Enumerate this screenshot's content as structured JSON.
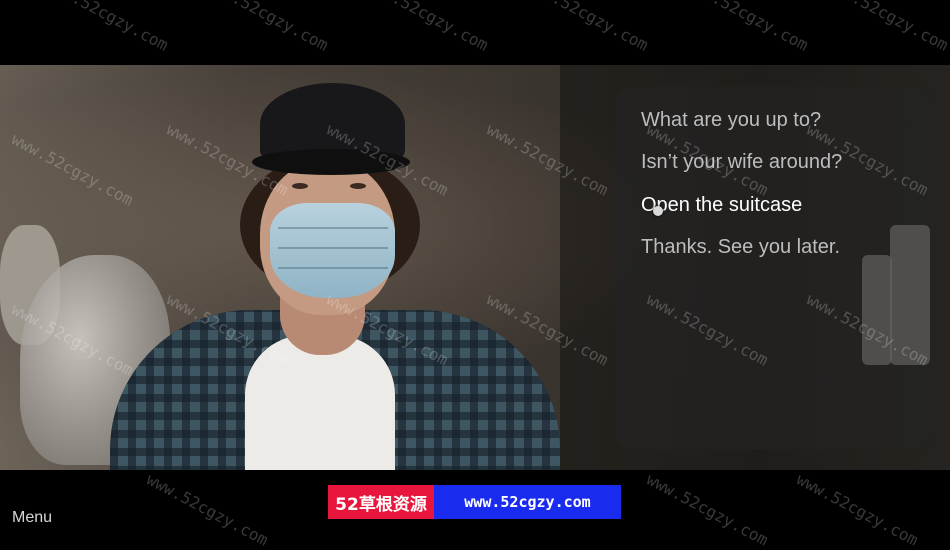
{
  "dialogue": {
    "options": [
      {
        "label": "What are you up to?",
        "selected": false
      },
      {
        "label": "Isn’t your wife around?",
        "selected": false
      },
      {
        "label": "Open the suitcase",
        "selected": true
      },
      {
        "label": "Thanks. See you later.",
        "selected": false
      }
    ]
  },
  "footer": {
    "menu_label": "Menu"
  },
  "promo_banner": {
    "left_text": "52草根资源",
    "right_text": "www.52cgzy.com",
    "left_color": "#e8163d",
    "right_color": "#1a2bf0"
  },
  "watermark_text": "www.52cgzy.com"
}
